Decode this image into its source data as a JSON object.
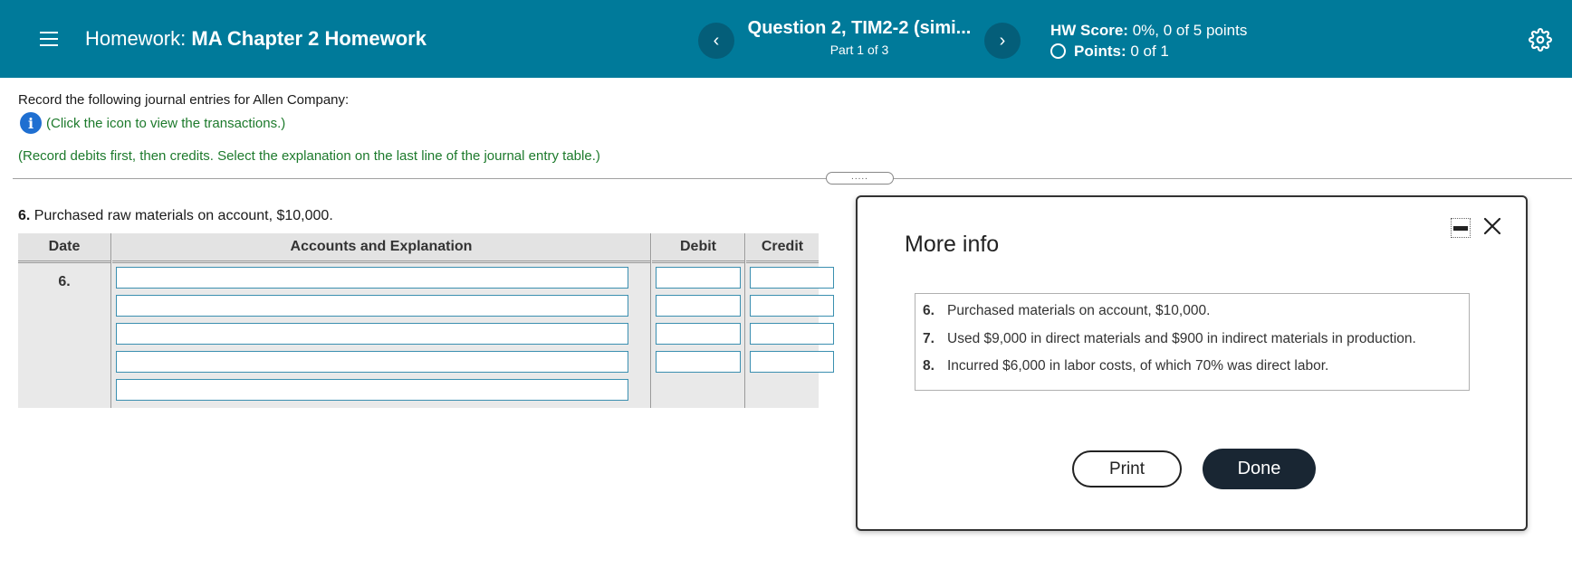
{
  "header": {
    "homework_label": "Homework:",
    "homework_name": "MA Chapter 2 Homework",
    "prev_label": "‹",
    "next_label": "›",
    "question_title": "Question 2, TIM2-2 (simi...",
    "question_part": "Part 1 of 3",
    "hw_score_label": "HW Score:",
    "hw_score_value": "0%, 0 of 5 points",
    "points_label": "Points:",
    "points_value": "0 of 1"
  },
  "instructions": {
    "intro": "Record the following journal entries for Allen Company:",
    "info_link": "(Click the icon to view the transactions.)",
    "record_note": "(Record debits first, then credits. Select the explanation on the last line of the journal entry table.)",
    "drag_handle": "....."
  },
  "question": {
    "number": "6.",
    "text": "Purchased raw materials on account, $10,000."
  },
  "journal": {
    "headers": {
      "date": "Date",
      "accounts": "Accounts and Explanation",
      "debit": "Debit",
      "credit": "Credit"
    },
    "date_value": "6."
  },
  "modal": {
    "title": "More info",
    "transactions": [
      {
        "num": "6.",
        "text": "Purchased materials on account, $10,000."
      },
      {
        "num": "7.",
        "text": "Used $9,000 in direct materials and $900 in indirect materials in production."
      },
      {
        "num": "8.",
        "text": "Incurred $6,000 in labor costs, of which 70% was direct labor."
      }
    ],
    "print_label": "Print",
    "done_label": "Done"
  },
  "colors": {
    "header_bg": "#007a9a",
    "nav_btn_bg": "#045e79",
    "green_text": "#1d7a2c",
    "info_icon_bg": "#1f6fd1",
    "done_bg": "#192633"
  },
  "icons": [
    "hamburger-menu-icon",
    "chevron-left-icon",
    "chevron-right-icon",
    "gear-icon",
    "info-icon",
    "minimize-icon",
    "close-icon"
  ]
}
